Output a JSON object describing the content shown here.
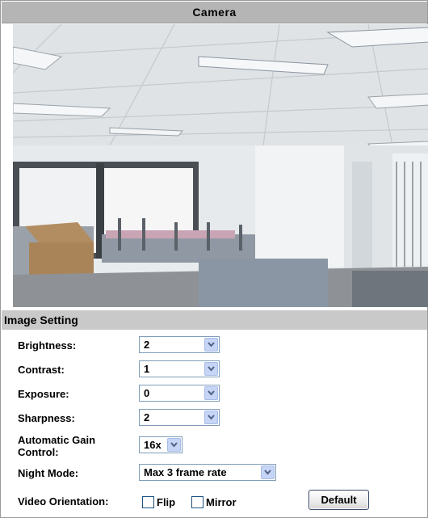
{
  "header": {
    "title": "Camera"
  },
  "image_setting": {
    "title": "Image Setting",
    "brightness": {
      "label": "Brightness:",
      "value": "2"
    },
    "contrast": {
      "label": "Contrast:",
      "value": "1"
    },
    "exposure": {
      "label": "Exposure:",
      "value": "0"
    },
    "sharpness": {
      "label": "Sharpness:",
      "value": "2"
    },
    "agc": {
      "label_line1": "Automatic Gain",
      "label_line2": "Control:",
      "value": "16x"
    },
    "night_mode": {
      "label": "Night Mode:",
      "value": "Max 3 frame rate"
    },
    "video_orientation": {
      "label": "Video Orientation:",
      "flip_label": "Flip",
      "flip_checked": false,
      "mirror_label": "Mirror",
      "mirror_checked": false
    },
    "default_button": "Default"
  },
  "icons": {
    "dropdown": "chevron-down-icon"
  },
  "colors": {
    "header_bg": "#b5b5b5",
    "section_bg": "#c9c9c9",
    "select_border": "#7f9db9",
    "arrow_bg": "#c6d5f5",
    "arrow_glyph": "#4d6185"
  }
}
